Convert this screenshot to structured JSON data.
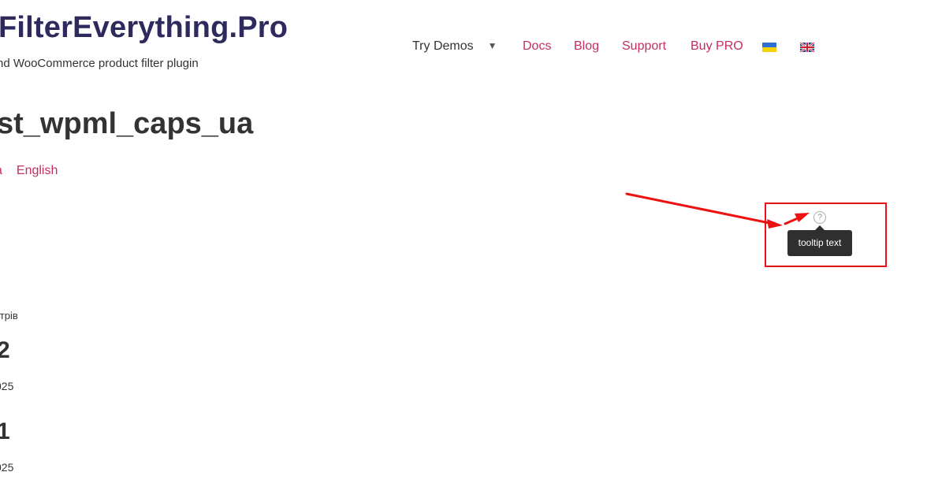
{
  "site": {
    "title": "FilterEverything.Pro",
    "tagline": "nd WooCommerce product filter plugin"
  },
  "nav": {
    "items": [
      {
        "label": "Try Demos",
        "caret": "▼"
      },
      {
        "label": "Docs"
      },
      {
        "label": "Blog"
      },
      {
        "label": "Support"
      },
      {
        "label": "Buy PRO"
      }
    ],
    "flags": [
      "ukraine-flag-icon",
      "uk-flag-icon"
    ]
  },
  "page": {
    "title": "st_wpml_caps_ua",
    "lang_links": [
      "a",
      "English"
    ],
    "filters_label": "ьтрів",
    "posts": [
      {
        "number": "2",
        "date": "025"
      },
      {
        "number": "1",
        "date": "025"
      }
    ]
  },
  "help": {
    "icon": "question-circle-icon",
    "symbol": "?",
    "tooltip": "tooltip text"
  },
  "colors": {
    "link": "#c2305d",
    "title": "#2e2a5e",
    "annotation": "#ee1111",
    "tooltip_bg": "#2f2f2f"
  }
}
